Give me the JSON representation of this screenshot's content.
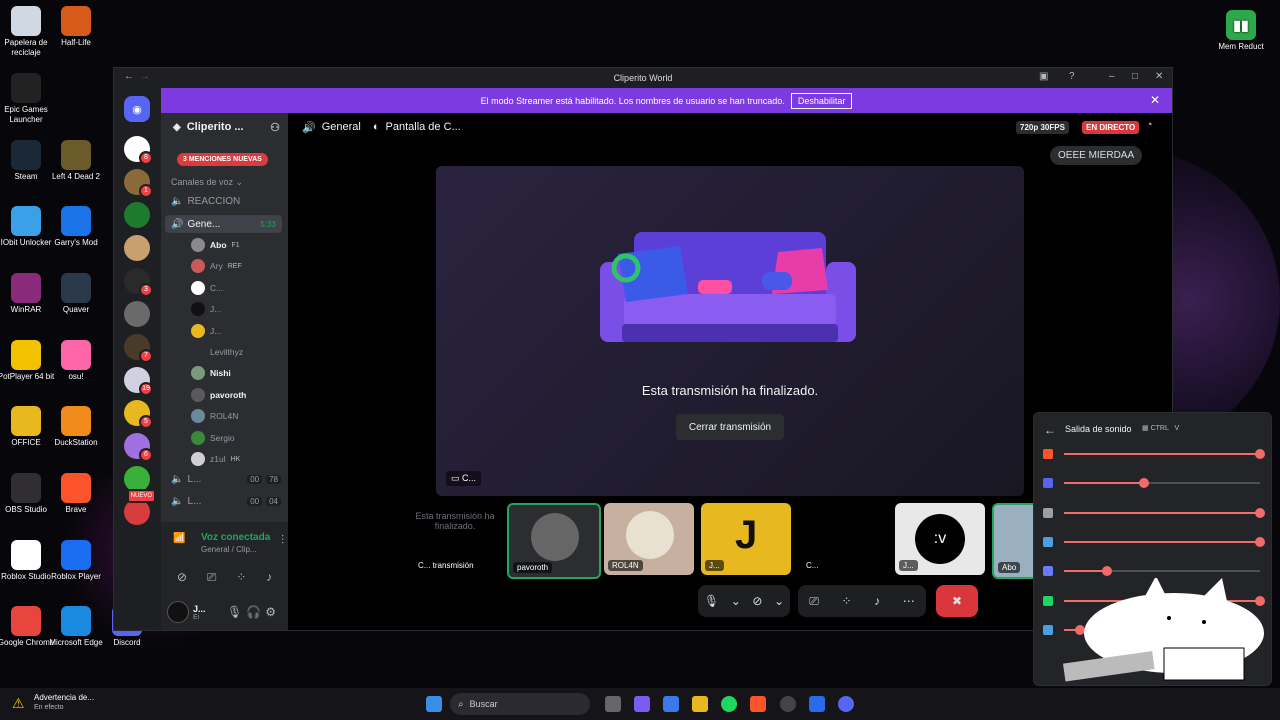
{
  "desktop": {
    "icons_left": [
      {
        "label": "Papelera de reciclaje",
        "icon": "recycle-bin-icon",
        "color": "#cfd8e3"
      },
      {
        "label": "Half-Life",
        "icon": "half-life-icon",
        "color": "#d85a1a"
      },
      {
        "label": "Epic Games Launcher",
        "icon": "epic-icon",
        "color": "#222222"
      },
      {
        "label": "Steam",
        "icon": "steam-icon",
        "color": "#1b2838"
      },
      {
        "label": "Left 4 Dead 2",
        "icon": "l4d2-icon",
        "color": "#6b5a2a"
      },
      {
        "label": "IObit Unlocker",
        "icon": "lock-icon",
        "color": "#3aa0e8"
      },
      {
        "label": "Garry's Mod",
        "icon": "gmod-icon",
        "color": "#1a74e8"
      },
      {
        "label": "WinRAR",
        "icon": "winrar-icon",
        "color": "#8a2a7a"
      },
      {
        "label": "Quaver",
        "icon": "quaver-icon",
        "color": "#2a3a4a"
      },
      {
        "label": "PotPlayer 64 bit",
        "icon": "potplayer-icon",
        "color": "#f2c200"
      },
      {
        "label": "osu!",
        "icon": "osu-icon",
        "color": "#ff66aa"
      },
      {
        "label": "OFFICE",
        "icon": "folder-icon",
        "color": "#e8b820"
      },
      {
        "label": "DuckStation",
        "icon": "duckstation-icon",
        "color": "#f08a1a"
      },
      {
        "label": "OBS Studio",
        "icon": "obs-icon",
        "color": "#302e31"
      },
      {
        "label": "Brave",
        "icon": "brave-icon",
        "color": "#fb542b"
      },
      {
        "label": "Roblox Studio",
        "icon": "roblox-icon",
        "color": "#ffffff"
      },
      {
        "label": "Roblox Player",
        "icon": "roblox-icon",
        "color": "#1a6cf0"
      },
      {
        "label": "Google Chrome",
        "icon": "chrome-icon",
        "color": "#e8453c"
      },
      {
        "label": "Microsoft Edge",
        "icon": "edge-icon",
        "color": "#1a8ae0"
      },
      {
        "label": "Discord",
        "icon": "discord-icon",
        "color": "#5865f2"
      }
    ],
    "icon_right": {
      "label": "Mem Reduct",
      "icon": "mem-reduct-icon",
      "color": "#2ea84a"
    }
  },
  "window": {
    "title": "Cliperito World",
    "banner_text": "El modo Streamer está habilitado. Los nombres de usuario se han truncado.",
    "banner_button": "Deshabilitar"
  },
  "servers": [
    {
      "badge": "8"
    },
    {
      "badge": "1"
    },
    {
      "badge": ""
    },
    {
      "badge": ""
    },
    {
      "badge": "3"
    },
    {
      "badge": ""
    },
    {
      "badge": "7"
    },
    {
      "badge": "19"
    },
    {
      "badge": "5"
    },
    {
      "badge": "6"
    },
    {
      "badge": ""
    },
    {
      "badge": "NUEVO"
    }
  ],
  "sidebar": {
    "server_name": "Cliperito ...",
    "mentions": "3 MENCIONES NUEVAS",
    "category": "Canales de voz",
    "channel_reaccion": "REACCION",
    "channel_general": "Gene...",
    "channel_general_time": "5:33",
    "users": [
      {
        "name": "Abo",
        "extra": "F1",
        "color": "#8a8a8a",
        "bright": true
      },
      {
        "name": "Ary",
        "extra": "REF",
        "color": "#c85a5a",
        "bright": false
      },
      {
        "name": "C...",
        "extra": "",
        "color": "#ffffff",
        "bright": false
      },
      {
        "name": "J...",
        "extra": "",
        "color": "#111111",
        "bright": false
      },
      {
        "name": "J...",
        "extra": "",
        "color": "#e8b820",
        "bright": false
      },
      {
        "name": "Levilthyz",
        "extra": "",
        "color": "#2b2d31",
        "bright": false
      },
      {
        "name": "Nishi",
        "extra": "",
        "color": "#7a9a7a",
        "bright": true
      },
      {
        "name": "pavoroth",
        "extra": "",
        "color": "#5a5a5a",
        "bright": true
      },
      {
        "name": "ROL4N",
        "extra": "",
        "color": "#6a8a9a",
        "bright": false
      },
      {
        "name": "Sergio",
        "extra": "",
        "color": "#3a8a3a",
        "bright": false
      },
      {
        "name": "z1ul",
        "extra": "HK",
        "color": "#d0d0d0",
        "bright": false
      }
    ],
    "other_channels": [
      {
        "name": "L...",
        "a": "00",
        "b": "78"
      },
      {
        "name": "L...",
        "a": "00",
        "b": "04"
      }
    ],
    "voice_status": "Voz conectada",
    "voice_sub": "General / Clip...",
    "me_name": "J...",
    "me_status": "Ei"
  },
  "main": {
    "channel": "General",
    "stream_title": "Pantalla de C...",
    "quality": "720p 30FPS",
    "live": "EN DIRECTO",
    "chip": "OEEE MIERDAA",
    "ended_text": "Esta transmisión ha finalizado.",
    "close_button": "Cerrar transmisión",
    "stage_label": "C...",
    "ended_small": "Esta transmisión ha finalizado.",
    "tiles": [
      {
        "label": "C... transmisión"
      },
      {
        "label": "pavoroth"
      },
      {
        "label": "ROL4N"
      },
      {
        "label": "J..."
      },
      {
        "label": "C..."
      },
      {
        "label": "J..."
      },
      {
        "label": "Abo"
      },
      {
        "label": "z1ul"
      }
    ]
  },
  "sound_panel": {
    "title": "Salida de sonido",
    "shortcut_key": "CTRL",
    "shortcut_letter": "V",
    "rows": [
      {
        "app": "brave-icon",
        "color": "#fb542b",
        "level": 1.0
      },
      {
        "app": "discord-icon",
        "color": "#5865f2",
        "level": 0.41
      },
      {
        "app": "app-icon",
        "color": "#9aa0a6",
        "level": 1.0
      },
      {
        "app": "app-icon",
        "color": "#4aa0e0",
        "level": 1.0
      },
      {
        "app": "app-icon",
        "color": "#6a7aff",
        "level": 0.22
      },
      {
        "app": "spotify-icon",
        "color": "#1ed760",
        "level": 1.0
      },
      {
        "app": "app-icon",
        "color": "#4aa0e0",
        "level": 0.08
      }
    ]
  },
  "taskbar": {
    "warning_title": "Advertencia de...",
    "warning_sub": "En efecto",
    "search": "Buscar"
  }
}
